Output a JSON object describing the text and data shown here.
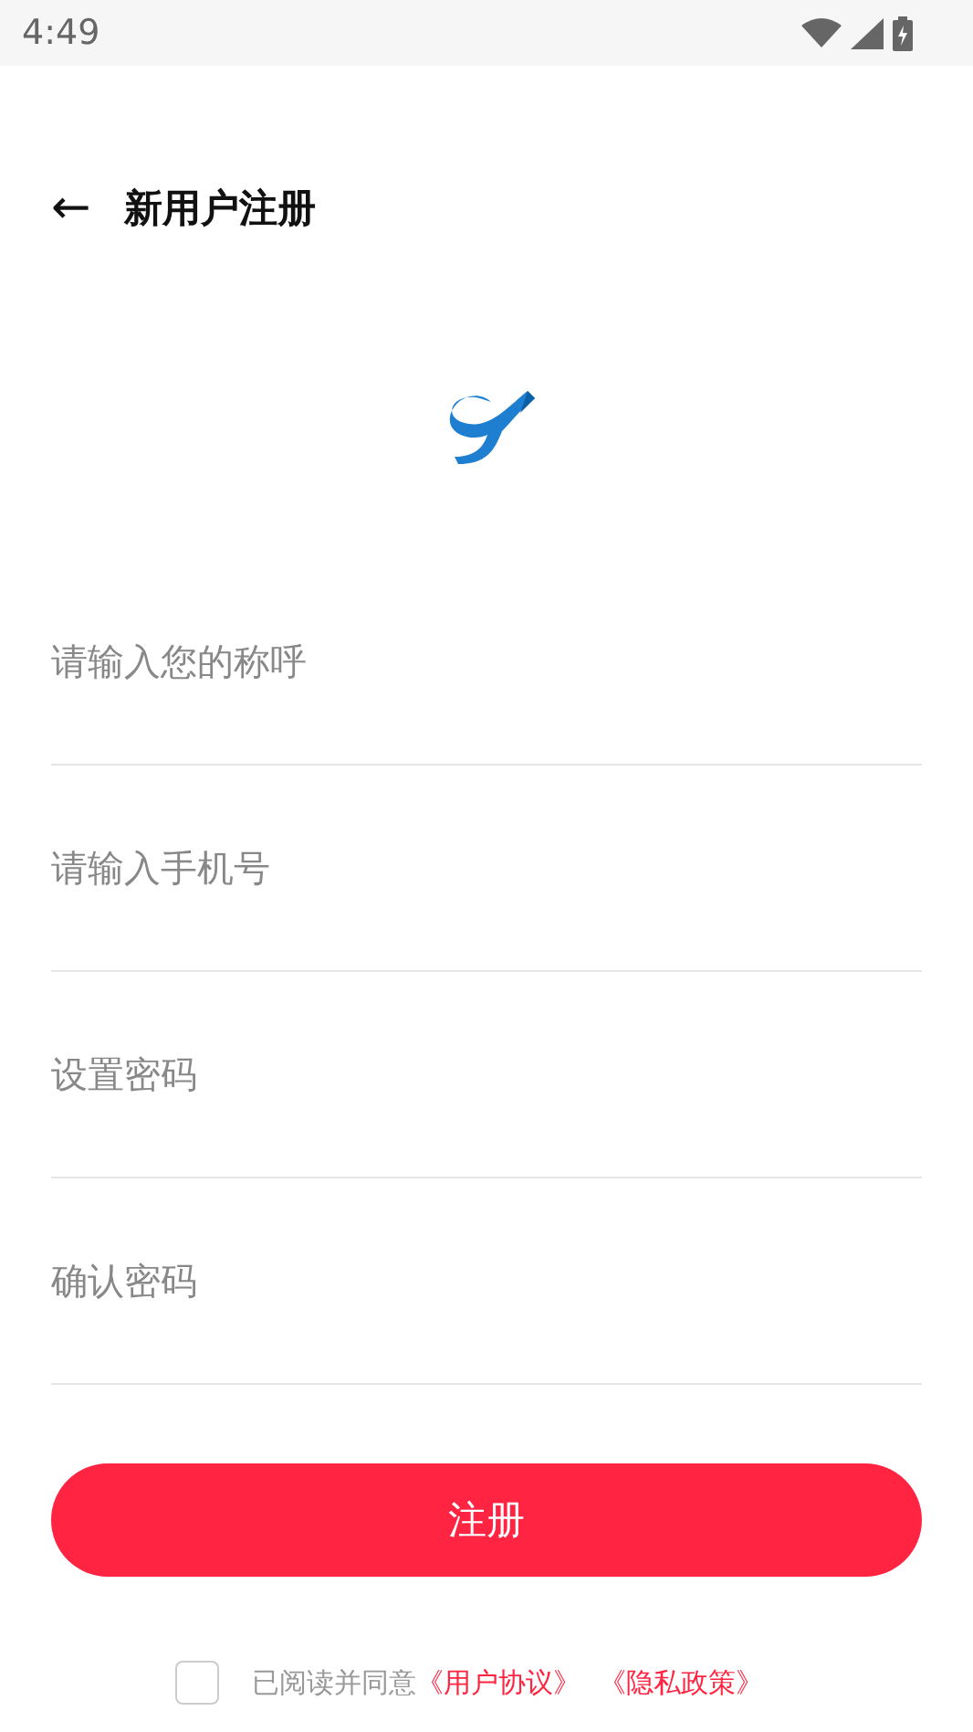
{
  "status_bar": {
    "time": "4:49"
  },
  "header": {
    "back": "←",
    "title": "新用户注册"
  },
  "fields": [
    {
      "placeholder": "请输入您的称呼"
    },
    {
      "placeholder": "请输入手机号"
    },
    {
      "placeholder": "设置密码"
    },
    {
      "placeholder": "确认密码"
    }
  ],
  "submit": {
    "label": "注册"
  },
  "agreement": {
    "checked": false,
    "text": "已阅读并同意",
    "links": [
      "《用户协议》",
      "《隐私政策》"
    ]
  }
}
